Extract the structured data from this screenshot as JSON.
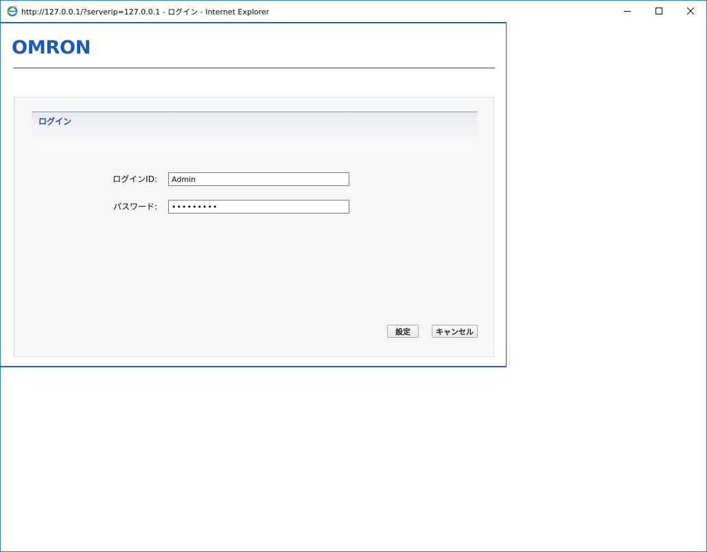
{
  "window": {
    "title": "http://127.0.0.1/?serverip=127.0.0.1 - ログイン - Internet Explorer"
  },
  "header": {
    "logo_text": "OMRON",
    "brand_color": "#1a5bb8"
  },
  "login_section": {
    "title": "ログイン",
    "fields": {
      "login_id": {
        "label": "ログインID:",
        "value": "Admin"
      },
      "password": {
        "label": "パスワード:",
        "value": "•••••••••"
      }
    },
    "buttons": {
      "set_label": "設定",
      "cancel_label": "キャンセル"
    }
  },
  "icons": {
    "app": "internet-explorer-icon",
    "minimize": "minimize-icon",
    "maximize": "maximize-icon",
    "close": "close-icon"
  }
}
